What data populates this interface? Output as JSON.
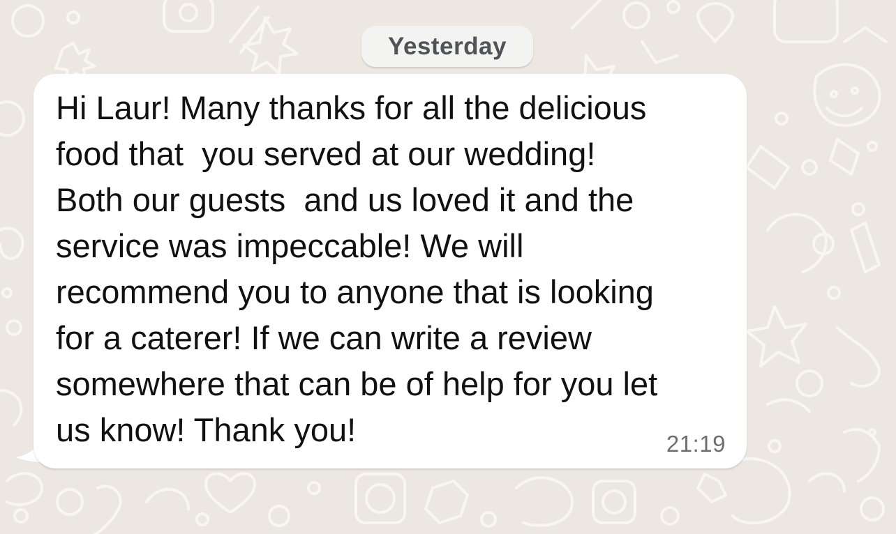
{
  "chat": {
    "date_separator": "Yesterday",
    "messages": [
      {
        "direction": "incoming",
        "text": "Hi Laur! Many thanks for all the delicious\nfood that  you served at our wedding!\nBoth our guests  and us loved it and the\nservice was impeccable! We will\nrecommend you to anyone that is looking\nfor a caterer! If we can write a review\nsomewhere that can be of help for you let\nus know! Thank you!",
        "time": "21:19"
      }
    ]
  },
  "colors": {
    "wallpaper": "#ece8e1",
    "wallpaper_doodle": "#f7f5f1",
    "bubble_incoming": "#ffffff",
    "date_chip": "#f3f3f1",
    "text": "#111111",
    "timestamp": "#6f6f6f"
  }
}
